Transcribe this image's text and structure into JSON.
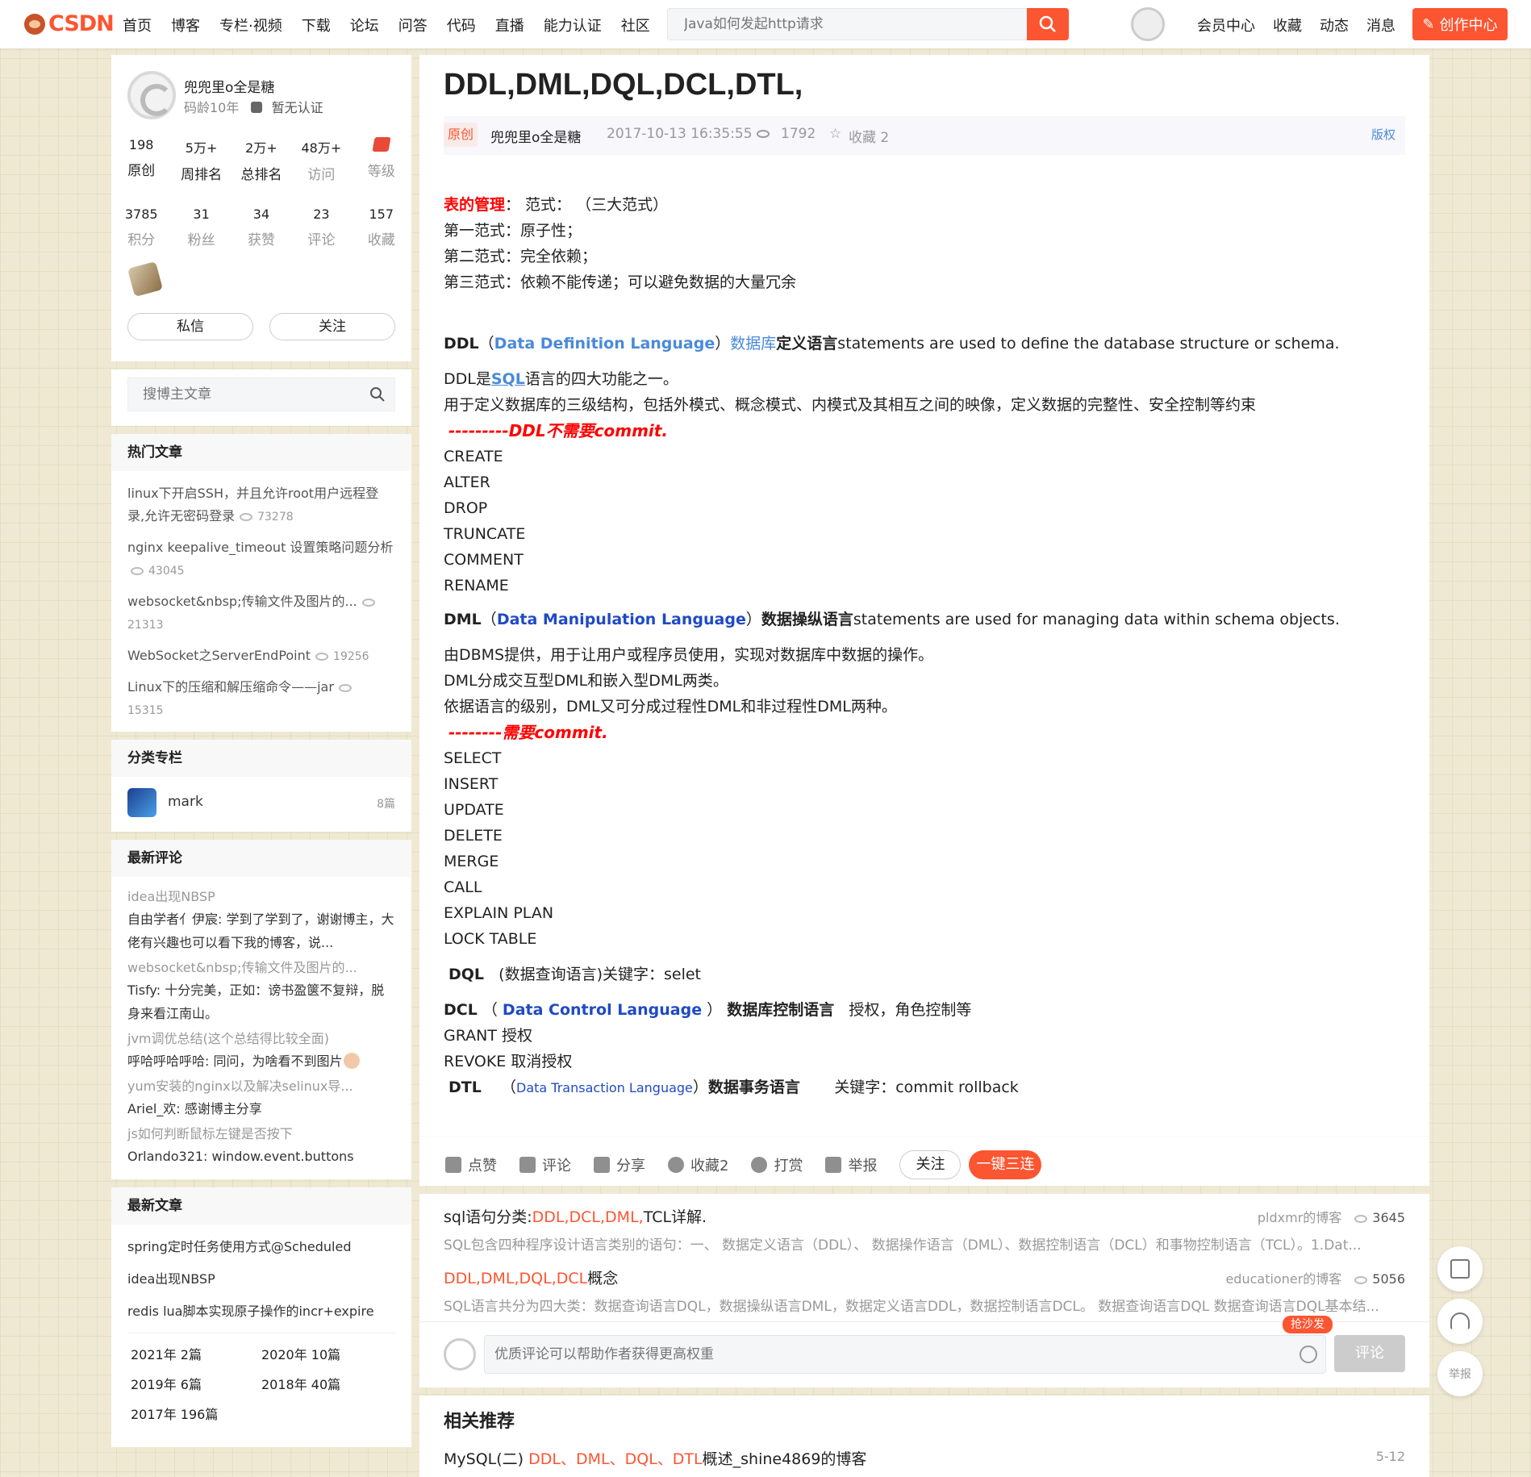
{
  "brand": "CSDN",
  "nav": [
    "首页",
    "博客",
    "专栏·视频",
    "下载",
    "论坛",
    "问答",
    "代码",
    "直播",
    "能力认证",
    "社区"
  ],
  "search_placeholder": "Java如何发起http请求",
  "top_right": [
    "会员中心",
    "收藏",
    "动态",
    "消息"
  ],
  "create_label": "创作中心",
  "profile": {
    "name": "兜兜里o全是糖",
    "age": "码龄10年",
    "cert": "暂无认证",
    "stats1": [
      {
        "n": "198",
        "l": "原创"
      },
      {
        "n": "5万+",
        "l": "周排名"
      },
      {
        "n": "2万+",
        "l": "总排名"
      },
      {
        "n": "48万+",
        "l": "访问"
      },
      {
        "n": "",
        "l": "等级"
      }
    ],
    "stats2": [
      {
        "n": "3785",
        "l": "积分"
      },
      {
        "n": "31",
        "l": "粉丝"
      },
      {
        "n": "34",
        "l": "获赞"
      },
      {
        "n": "23",
        "l": "评论"
      },
      {
        "n": "157",
        "l": "收藏"
      }
    ],
    "msg_btn": "私信",
    "follow_btn": "关注"
  },
  "side_search_placeholder": "搜博主文章",
  "hot": {
    "title": "热门文章",
    "items": [
      {
        "t": "linux下开启SSH，并且允许root用户远程登录,允许无密码登录",
        "c": "73278"
      },
      {
        "t": "nginx keepalive_timeout 设置策略问题分析",
        "c": "43045"
      },
      {
        "t": "websocket&nbsp;传输文件及图片的...",
        "c": "21313"
      },
      {
        "t": "WebSocket之ServerEndPoint",
        "c": "19256"
      },
      {
        "t": "Linux下的压缩和解压缩命令——jar",
        "c": "15315"
      }
    ]
  },
  "category": {
    "title": "分类专栏",
    "name": "mark",
    "count": "8篇"
  },
  "comments": {
    "title": "最新评论",
    "items": [
      {
        "t": "idea出现NBSP",
        "b": "自由学者亻伊宸: 学到了学到了，谢谢博主，大佬有兴趣也可以看下我的博客，说..."
      },
      {
        "t": "websocket&nbsp;传输文件及图片的...",
        "b": "Tisfy: 十分完美，正如：谤书盈箧不复辩，脱身来看江南山。"
      },
      {
        "t": "jvm调优总结(这个总结得比较全面)",
        "b": "呼哈呼哈呼哈: 同问，为啥看不到图片"
      },
      {
        "t": "yum安装的nginx以及解决selinux导...",
        "b": "Ariel_欢: 感谢博主分享"
      },
      {
        "t": "js如何判断鼠标左键是否按下",
        "b": "Orlando321: window.event.buttons"
      }
    ]
  },
  "latest": {
    "title": "最新文章",
    "items": [
      "spring定时任务使用方式@Scheduled",
      "idea出现NBSP",
      "redis lua脚本实现原子操作的incr+expire"
    ],
    "archive": [
      "2021年  2篇",
      "2020年  10篇",
      "2019年  6篇",
      "2018年  40篇",
      "2017年  196篇"
    ]
  },
  "article": {
    "title": "DDL,DML,DQL,DCL,DTL,",
    "orig": "原创",
    "author": "兜兜里o全是糖",
    "date": "2017-10-13 16:35:55",
    "views": "1792",
    "fav": "收藏 2",
    "copyright": "版权",
    "tbl_mgmt": "表的管理",
    "l1": "：  范式：  （三大范式）",
    "l2": "第一范式：原子性；",
    "l3": "第二范式：完全依赖；",
    "l4": "第三范式：依赖不能传递；可以避免数据的大量冗余",
    "ddl_head": "DDL",
    "ddl_full": "Data Definition Language",
    "ddl_db": "数据库",
    "ddl_cn": "定义语言",
    "ddl_en": "statements are used to define the database structure or schema.",
    "ddl_a": "DDL是",
    "ddl_sql": "SQL",
    "ddl_b": "语言的四大功能之一。",
    "ddl_c": "用于定义数据库的三级结构，包括外模式、概念模式、内模式及其相互之间的映像，定义数据的完整性、安全控制等约束",
    "ddl_note": "---------DDL不需要commit.",
    "ddl_cmds": [
      "CREATE",
      "ALTER",
      "DROP",
      "TRUNCATE",
      "COMMENT",
      "RENAME"
    ],
    "dml_head": "DML",
    "dml_full": "Data Manipulation Language",
    "dml_cn": "数据操纵语言",
    "dml_en": "statements are used for managing data within schema objects.",
    "dml_a": "由DBMS提供，用于让用户或程序员使用，实现对数据库中数据的操作。",
    "dml_b": "DML分成交互型DML和嵌入型DML两类。",
    "dml_c": "依据语言的级别，DML又可分成过程性DML和非过程性DML两种。",
    "dml_note": "--------需要commit.",
    "dml_cmds": [
      "SELECT",
      "INSERT",
      "UPDATE",
      "DELETE",
      "MERGE",
      "CALL",
      "EXPLAIN PLAN",
      "LOCK TABLE"
    ],
    "dql_head": "DQL",
    "dql_text": "(数据查询语言)关键字：selet",
    "dcl_head": "DCL",
    "dcl_full": "Data Control Language",
    "dcl_cn": "数据库控制语言",
    "dcl_text": "授权，角色控制等",
    "dcl_grant": "GRANT 授权",
    "dcl_revoke": "REVOKE 取消授权",
    "dtl_head": "DTL",
    "dtl_full": "Data Transaction Language",
    "dtl_cn": "数据事务语言",
    "dtl_text": "关键字：commit   rollback"
  },
  "toolbar": [
    "点赞",
    "评论",
    "分享",
    "收藏2",
    "打赏",
    "举报"
  ],
  "toolbar_follow": "关注",
  "toolbar_sanlian": "一键三连",
  "recs": [
    {
      "t1": "sql语句分类:",
      "t2": "DDL,DCL,DML,",
      "t3": "TCL详解.",
      "src": "pldxmr的博客",
      "cnt": "3645",
      "d": "SQL包含四种程序设计语言类别的语句：一、 数据定义语言（DDL）、 数据操作语言（DML）、数据控制语言（DCL）和事物控制语言（TCL）。1.Dat..."
    },
    {
      "t1": "",
      "t2": "DDL,DML,DQL,DCL",
      "t3": "概念",
      "src": "educationer的博客",
      "cnt": "5056",
      "d": "SQL语言共分为四大类：数据查询语言DQL，数据操纵语言DML，数据定义语言DDL，数据控制语言DCL。 数据查询语言DQL 数据查询语言DQL基本结..."
    }
  ],
  "comment_placeholder": "优质评论可以帮助作者获得更高权重",
  "shafa": "抢沙发",
  "comment_send": "评论",
  "related_title": "相关推荐",
  "related_item": {
    "a": "MySQL(二) ",
    "b": "DDL",
    "c": "、",
    "d": "DML",
    "e": "、",
    "f": "DQL",
    "g": "、",
    "h": "DTL",
    "i": "概述_shine4869的博客",
    "date": "5-12"
  },
  "float_report": "举报"
}
